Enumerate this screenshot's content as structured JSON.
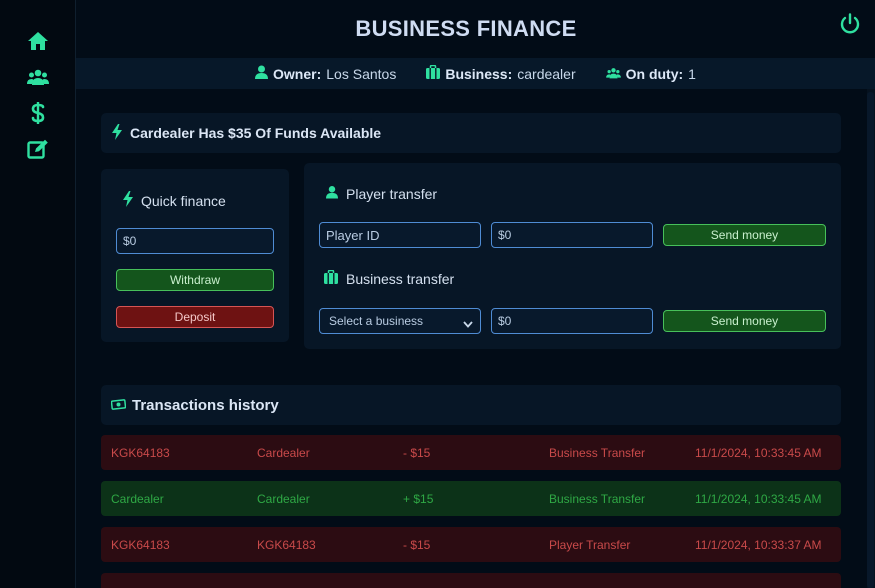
{
  "header": {
    "title": "BUSINESS FINANCE"
  },
  "info": {
    "owner_label": "Owner:",
    "owner_value": "Los Santos",
    "business_label": "Business:",
    "business_value": "cardealer",
    "duty_label": "On duty:",
    "duty_value": "1"
  },
  "funds": {
    "text": "Cardealer Has $35 Of Funds Available"
  },
  "quick_finance": {
    "title": "Quick finance",
    "amount_placeholder": "$0",
    "withdraw_label": "Withdraw",
    "deposit_label": "Deposit"
  },
  "player_transfer": {
    "title": "Player transfer",
    "id_placeholder": "Player ID",
    "amount_placeholder": "$0",
    "send_label": "Send money"
  },
  "business_transfer": {
    "title": "Business transfer",
    "select_value": "Select a business",
    "amount_placeholder": "$0",
    "send_label": "Send money"
  },
  "history": {
    "title": "Transactions history",
    "rows": [
      {
        "from": "KGK64183",
        "to": "Cardealer",
        "amount": "- $15",
        "type": "Business Transfer",
        "date": "11/1/2024, 10:33:45 AM",
        "status": "negative"
      },
      {
        "from": "Cardealer",
        "to": "Cardealer",
        "amount": "+ $15",
        "type": "Business Transfer",
        "date": "11/1/2024, 10:33:45 AM",
        "status": "positive"
      },
      {
        "from": "KGK64183",
        "to": "KGK64183",
        "amount": "- $15",
        "type": "Player Transfer",
        "date": "11/1/2024, 10:33:37 AM",
        "status": "negative"
      }
    ]
  },
  "colors": {
    "accent": "#2fe0a0",
    "negative": "#c94a4a",
    "positive": "#2fa845"
  },
  "icons": [
    "home-icon",
    "users-icon",
    "dollar-icon",
    "edit-icon",
    "power-icon",
    "user-icon",
    "briefcase-icon",
    "bolt-icon",
    "money-icon"
  ]
}
